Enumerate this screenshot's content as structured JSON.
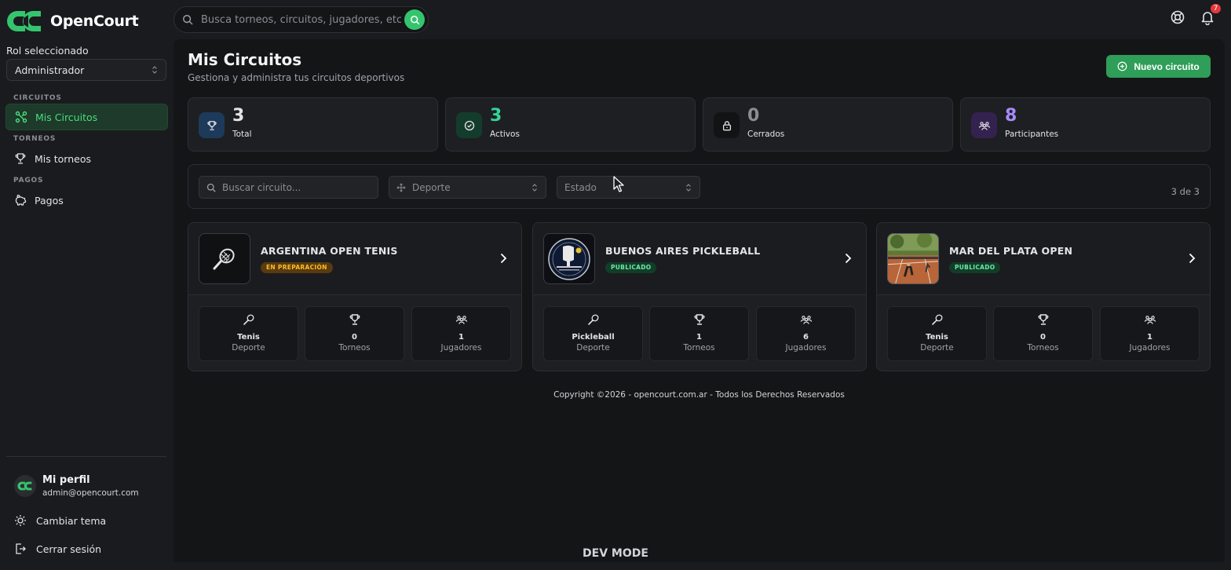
{
  "brand": {
    "name": "OpenCourt"
  },
  "search": {
    "placeholder": "Busca torneos, circuitos, jugadores, etc."
  },
  "notifications": {
    "count": "7"
  },
  "sidebar": {
    "role_label": "Rol seleccionado",
    "role_value": "Administrador",
    "sections": [
      {
        "label": "CIRCUITOS",
        "item": "Mis Circuitos"
      },
      {
        "label": "TORNEOS",
        "item": "Mis torneos"
      },
      {
        "label": "PAGOS",
        "item": "Pagos"
      }
    ],
    "profile": {
      "name": "Mi perfil",
      "email": "admin@opencourt.com"
    },
    "theme_label": "Cambiar tema",
    "logout_label": "Cerrar sesión"
  },
  "page": {
    "title": "Mis Circuitos",
    "subtitle": "Gestiona y administra tus circuitos deportivos",
    "new_button": "Nuevo circuito"
  },
  "stats": [
    {
      "value": "3",
      "label": "Total",
      "color": "#e4e4e7",
      "icon": "trophy-icon"
    },
    {
      "value": "3",
      "label": "Activos",
      "color": "#34d399",
      "icon": "check-circle-icon"
    },
    {
      "value": "0",
      "label": "Cerrados",
      "color": "#8b8d93",
      "icon": "lock-icon"
    },
    {
      "value": "8",
      "label": "Participantes",
      "color": "#a78bfa",
      "icon": "users-icon"
    }
  ],
  "filters": {
    "search_placeholder": "Buscar circuito...",
    "sport_placeholder": "Deporte",
    "status_placeholder": "Estado",
    "count": "3 de 3"
  },
  "circuits": [
    {
      "name": "ARGENTINA OPEN TENIS",
      "badge": "EN PREPARACIÓN",
      "sport": "Tenis",
      "sport_label": "Deporte",
      "tournaments": "0",
      "tournaments_label": "Torneos",
      "players": "1",
      "players_label": "Jugadores"
    },
    {
      "name": "BUENOS AIRES PICKLEBALL",
      "badge": "PUBLICADO",
      "sport": "Pickleball",
      "sport_label": "Deporte",
      "tournaments": "1",
      "tournaments_label": "Torneos",
      "players": "6",
      "players_label": "Jugadores"
    },
    {
      "name": "MAR DEL PLATA OPEN",
      "badge": "PUBLICADO",
      "sport": "Tenis",
      "sport_label": "Deporte",
      "tournaments": "0",
      "tournaments_label": "Torneos",
      "players": "1",
      "players_label": "Jugadores"
    }
  ],
  "footer": {
    "copyright": "Copyright ©2026 - opencourt.com.ar - Todos los Derechos Reservados"
  },
  "dev_mode": "DEV MODE",
  "colors": {
    "accent": "#2f9e58",
    "accent_text": "#4ade80",
    "badge_warning": "#fbbf24"
  }
}
